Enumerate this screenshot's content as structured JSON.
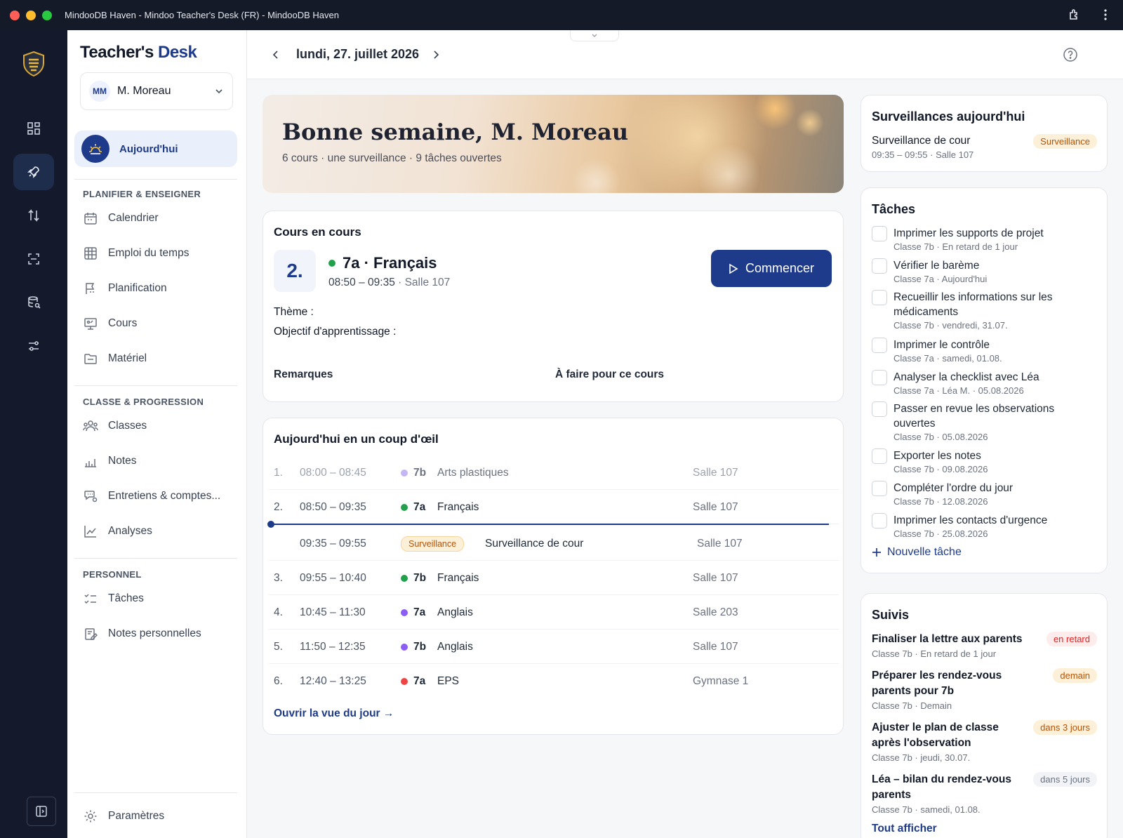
{
  "window": {
    "title": "MindooDB Haven - Mindoo Teacher's Desk (FR) - MindooDB Haven"
  },
  "brand": {
    "part1": "Teacher's",
    "part2": "Desk"
  },
  "user": {
    "initials": "MM",
    "name": "M. Moreau"
  },
  "sidebar": {
    "today_label": "Aujourd'hui",
    "sections": {
      "plan": "PLANIFIER & ENSEIGNER",
      "class": "CLASSE & PROGRESSION",
      "personal": "PERSONNEL"
    },
    "plan_items": [
      "Calendrier",
      "Emploi du temps",
      "Planification",
      "Cours",
      "Matériel"
    ],
    "class_items": [
      "Classes",
      "Notes",
      "Entretiens & comptes...",
      "Analyses"
    ],
    "personal_items": [
      "Tâches",
      "Notes personnelles"
    ],
    "settings": "Paramètres"
  },
  "topbar": {
    "date": "lundi, 27. juillet 2026"
  },
  "hero": {
    "title": "Bonne semaine, M. Moreau",
    "subtitle": "6 cours · une surveillance · 9 tâches ouvertes"
  },
  "current_lesson": {
    "title": "Cours en cours",
    "period": "2.",
    "name": "7a · Français",
    "time": "08:50 – 09:35",
    "room": "· Salle 107",
    "dot_color": "#22a04b",
    "start_label": "Commencer",
    "theme_label": "Thème :",
    "objective_label": "Objectif d'apprentissage :",
    "remarks_label": "Remarques",
    "todo_label": "À faire pour ce cours"
  },
  "glance": {
    "title": "Aujourd'hui en un coup d'œil",
    "rows": [
      {
        "num": "1.",
        "time": "08:00 – 08:45",
        "class": "7b",
        "subject": "Arts plastiques",
        "room": "Salle 107",
        "dot": "#c4b5f5"
      },
      {
        "num": "2.",
        "time": "08:50 – 09:35",
        "class": "7a",
        "subject": "Français",
        "room": "Salle 107",
        "dot": "#22a04b"
      },
      {
        "num": "",
        "time": "09:35 – 09:55",
        "badge": "Surveillance",
        "subject": "Surveillance de cour",
        "room": "Salle 107"
      },
      {
        "num": "3.",
        "time": "09:55 – 10:40",
        "class": "7b",
        "subject": "Français",
        "room": "Salle 107",
        "dot": "#22a04b"
      },
      {
        "num": "4.",
        "time": "10:45 – 11:30",
        "class": "7a",
        "subject": "Anglais",
        "room": "Salle 203",
        "dot": "#8b5cf6"
      },
      {
        "num": "5.",
        "time": "11:50 – 12:35",
        "class": "7b",
        "subject": "Anglais",
        "room": "Salle 107",
        "dot": "#8b5cf6"
      },
      {
        "num": "6.",
        "time": "12:40 – 13:25",
        "class": "7a",
        "subject": "EPS",
        "room": "Gymnase 1",
        "dot": "#ef4444"
      }
    ],
    "link": "Ouvrir la vue du jour →"
  },
  "supervision": {
    "title": "Surveillances aujourd'hui",
    "item_title": "Surveillance de cour",
    "item_sub": "09:35 – 09:55 · Salle 107",
    "badge": "Surveillance"
  },
  "tasks": {
    "title": "Tâches",
    "items": [
      {
        "title": "Imprimer les supports de projet",
        "sub": "Classe 7b · En retard de 1 jour"
      },
      {
        "title": "Vérifier le barème",
        "sub": "Classe 7a · Aujourd'hui"
      },
      {
        "title": "Recueillir les informations sur les médicaments",
        "sub": "Classe 7b · vendredi, 31.07."
      },
      {
        "title": "Imprimer le contrôle",
        "sub": "Classe 7a · samedi, 01.08."
      },
      {
        "title": "Analyser la checklist avec Léa",
        "sub": "Classe 7a · Léa M. · 05.08.2026"
      },
      {
        "title": "Passer en revue les observations ouvertes",
        "sub": "Classe 7b · 05.08.2026"
      },
      {
        "title": "Exporter les notes",
        "sub": "Classe 7b · 09.08.2026"
      },
      {
        "title": "Compléter l'ordre du jour",
        "sub": "Classe 7b · 12.08.2026"
      },
      {
        "title": "Imprimer les contacts d'urgence",
        "sub": "Classe 7b · 25.08.2026"
      }
    ],
    "new_label": "Nouvelle tâche"
  },
  "followups": {
    "title": "Suivis",
    "items": [
      {
        "title": "Finaliser la lettre aux parents",
        "sub": "Classe 7b · En retard de 1 jour",
        "badge": "en retard",
        "kind": "red"
      },
      {
        "title": "Préparer les rendez-vous parents pour 7b",
        "sub": "Classe 7b · Demain",
        "badge": "demain",
        "kind": "amber"
      },
      {
        "title": "Ajuster le plan de classe après l'observation",
        "sub": "Classe 7b · jeudi, 30.07.",
        "badge": "dans 3 jours",
        "kind": "amber"
      },
      {
        "title": "Léa – bilan du rendez-vous parents",
        "sub": "Classe 7b · samedi, 01.08.",
        "badge": "dans 5 jours",
        "kind": "gray"
      }
    ],
    "see_all": "Tout afficher"
  },
  "icons": {
    "rail": [
      "dashboard-icon",
      "rocket-icon",
      "sort-icon",
      "scan-icon",
      "database-search-icon",
      "sliders-icon"
    ],
    "accent": "#1e3a8a"
  }
}
